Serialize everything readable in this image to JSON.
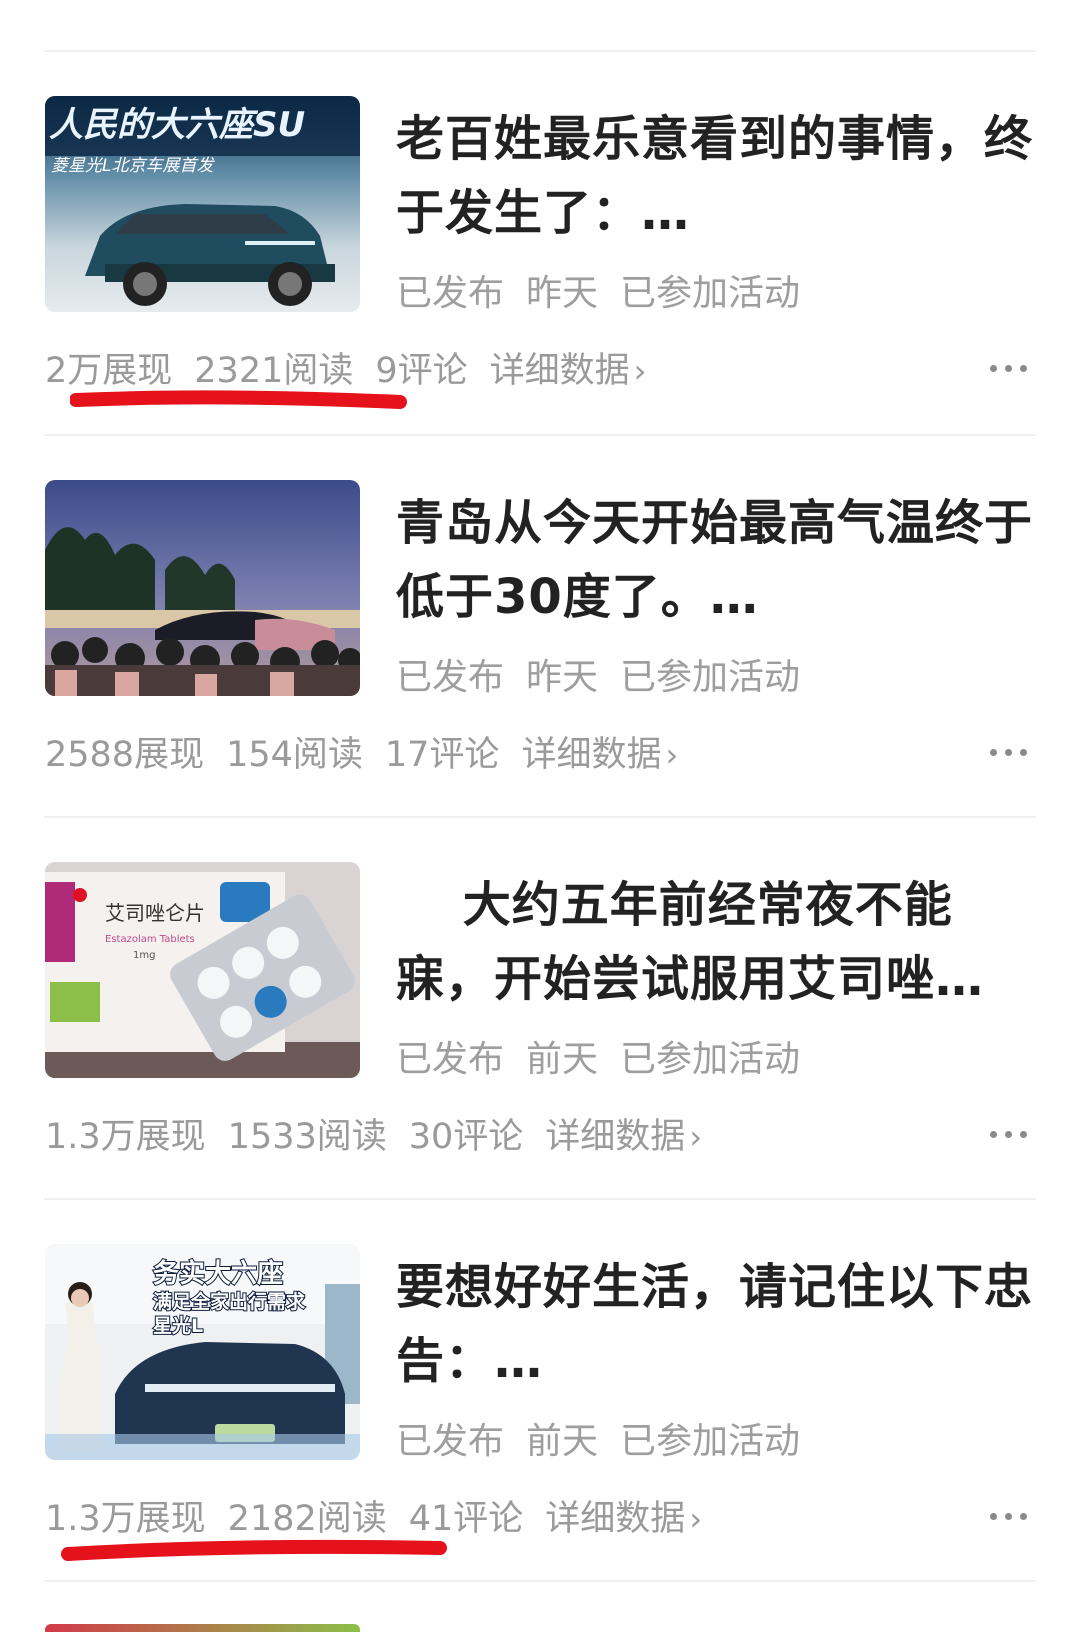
{
  "articles": [
    {
      "title": "老百姓最乐意看到的事情，终于发生了：…",
      "status": "已发布",
      "time": "昨天",
      "activity": "已参加活动",
      "impressions": "2万展现",
      "reads": "2321阅读",
      "comments": "9评论",
      "detail": "详细数据",
      "thumb_text_1": "人民的大六座SU",
      "thumb_text_2": "菱星光L北京车展首发"
    },
    {
      "title": "青岛从今天开始最高气温终于低于30度了。…",
      "status": "已发布",
      "time": "昨天",
      "activity": "已参加活动",
      "impressions": "2588展现",
      "reads": "154阅读",
      "comments": "17评论",
      "detail": "详细数据"
    },
    {
      "title": "　 大约五年前经常夜不能寐，开始尝试服用艾司唑…",
      "status": "已发布",
      "time": "前天",
      "activity": "已参加活动",
      "impressions": "1.3万展现",
      "reads": "1533阅读",
      "comments": "30评论",
      "detail": "详细数据",
      "thumb_text_1": "艾司唑仑片",
      "thumb_text_2": "Estazolam Tablets",
      "thumb_text_3": "1mg"
    },
    {
      "title": "要想好好生活，请记住以下忠告：…",
      "status": "已发布",
      "time": "前天",
      "activity": "已参加活动",
      "impressions": "1.3万展现",
      "reads": "2182阅读",
      "comments": "41评论",
      "detail": "详细数据",
      "thumb_text_1": "务实大六座",
      "thumb_text_2": "满足全家出行需求",
      "thumb_text_3": "星光L"
    }
  ],
  "icons": {
    "chevron": "chevron-right-icon",
    "more": "more-dots-icon"
  },
  "colors": {
    "annotation_red": "#e5121b",
    "stat_gray": "#9a9a9a",
    "title_black": "#222222"
  }
}
